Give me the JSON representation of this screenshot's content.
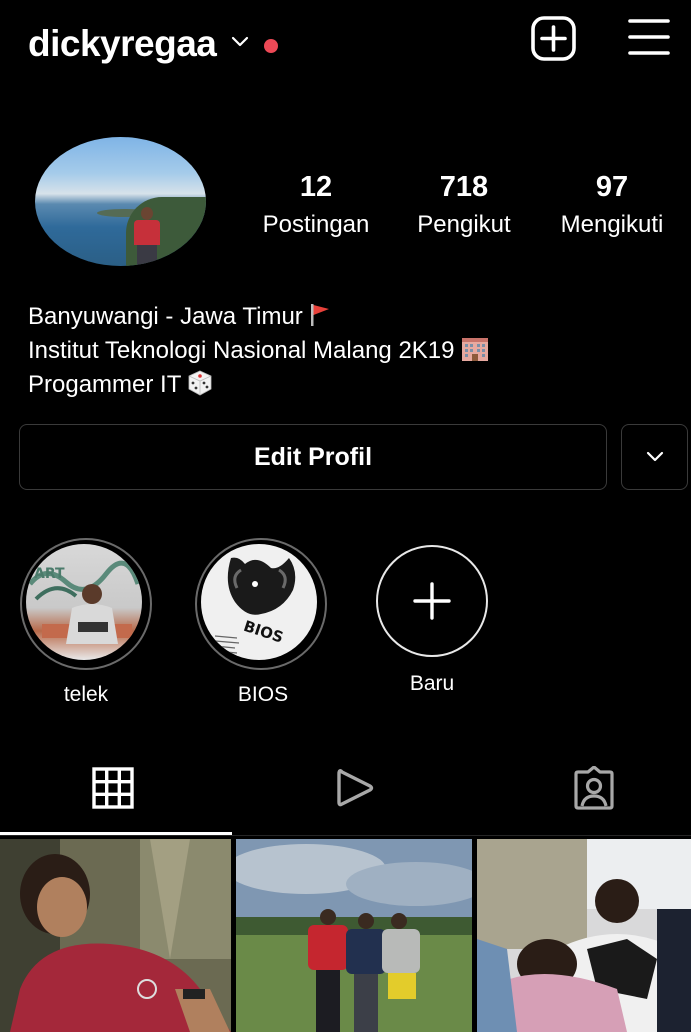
{
  "header": {
    "username": "dickyregaa",
    "chevron_icon": "chevron-down-icon",
    "notification_color": "#ed4956",
    "new_post_icon": "plus-square-icon",
    "menu_icon": "hamburger-menu-icon"
  },
  "profile": {
    "avatar_icon": "profile-avatar",
    "stats": [
      {
        "value": "12",
        "label": "Postingan"
      },
      {
        "value": "718",
        "label": "Pengikut"
      },
      {
        "value": "97",
        "label": "Mengikuti"
      }
    ],
    "bio": [
      {
        "text": "Banyuwangi - Jawa Timur",
        "emoji": "red-flag-icon"
      },
      {
        "text": "Institut Teknologi Nasional Malang 2K19",
        "emoji": "office-building-icon"
      },
      {
        "text": "Progammer IT",
        "emoji": "dice-icon"
      }
    ]
  },
  "actions": {
    "edit_profile": "Edit Profil",
    "more_icon": "chevron-down-icon"
  },
  "highlights": [
    {
      "label": "telek"
    },
    {
      "label": "BIOS",
      "image_text": "BIOS"
    },
    {
      "label": "Baru",
      "icon": "plus-icon"
    }
  ],
  "tabs": [
    {
      "icon": "grid-icon",
      "active": true
    },
    {
      "icon": "reels-play-icon",
      "active": false
    },
    {
      "icon": "tagged-person-icon",
      "active": false
    }
  ],
  "posts": [
    {
      "icon": "photo-thumbnail"
    },
    {
      "icon": "photo-thumbnail"
    },
    {
      "icon": "photo-thumbnail"
    }
  ],
  "colors": {
    "background": "#000000",
    "text": "#ffffff",
    "border": "#3a3a3a",
    "accent_red": "#ed4956"
  }
}
